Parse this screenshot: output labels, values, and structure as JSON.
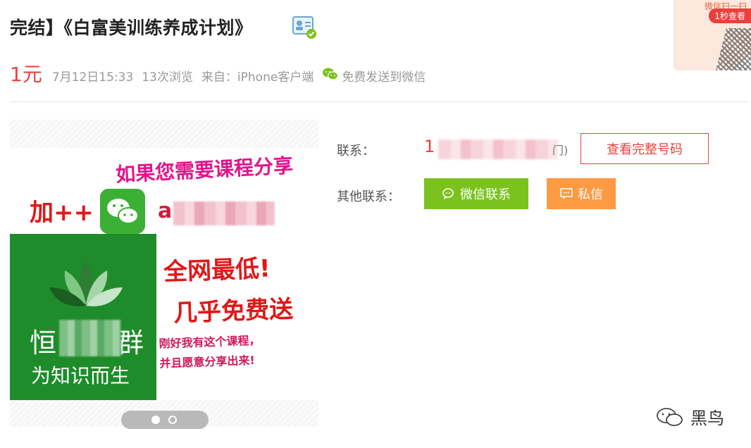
{
  "header": {
    "title": "完结】《白富美训练养成计划》"
  },
  "qr_promo": {
    "top_text": "微信扫一扫",
    "pill_text": "1秒查看"
  },
  "meta": {
    "price": "1元",
    "time": "7月12日15:33",
    "views": "13次浏览",
    "source": "来自：iPhone客户端",
    "send_to_wechat": "免费发送到微信"
  },
  "poster": {
    "line1": "如果您需要课程分享",
    "plus": "加++",
    "id_prefix": "a",
    "line2": "全网最低!",
    "line3": "几乎免费送",
    "line4a": "刚好我有这个课程，",
    "line4b": "并且愿意分享出来!",
    "brand": "恒",
    "brand_end": "群",
    "slogan": "为知识而生"
  },
  "contact": {
    "label": "联系：",
    "phone_prefix": "1",
    "phone_suffix": "门)",
    "view_full_label": "查看完整号码",
    "other_label": "其他联系：",
    "wechat_label": "微信联系",
    "message_label": "私信"
  },
  "watermark": {
    "text": "黑鸟"
  },
  "colors": {
    "accent": "#e8413c",
    "wechat_green": "#7cc21e",
    "message_orange": "#ff9a44"
  }
}
